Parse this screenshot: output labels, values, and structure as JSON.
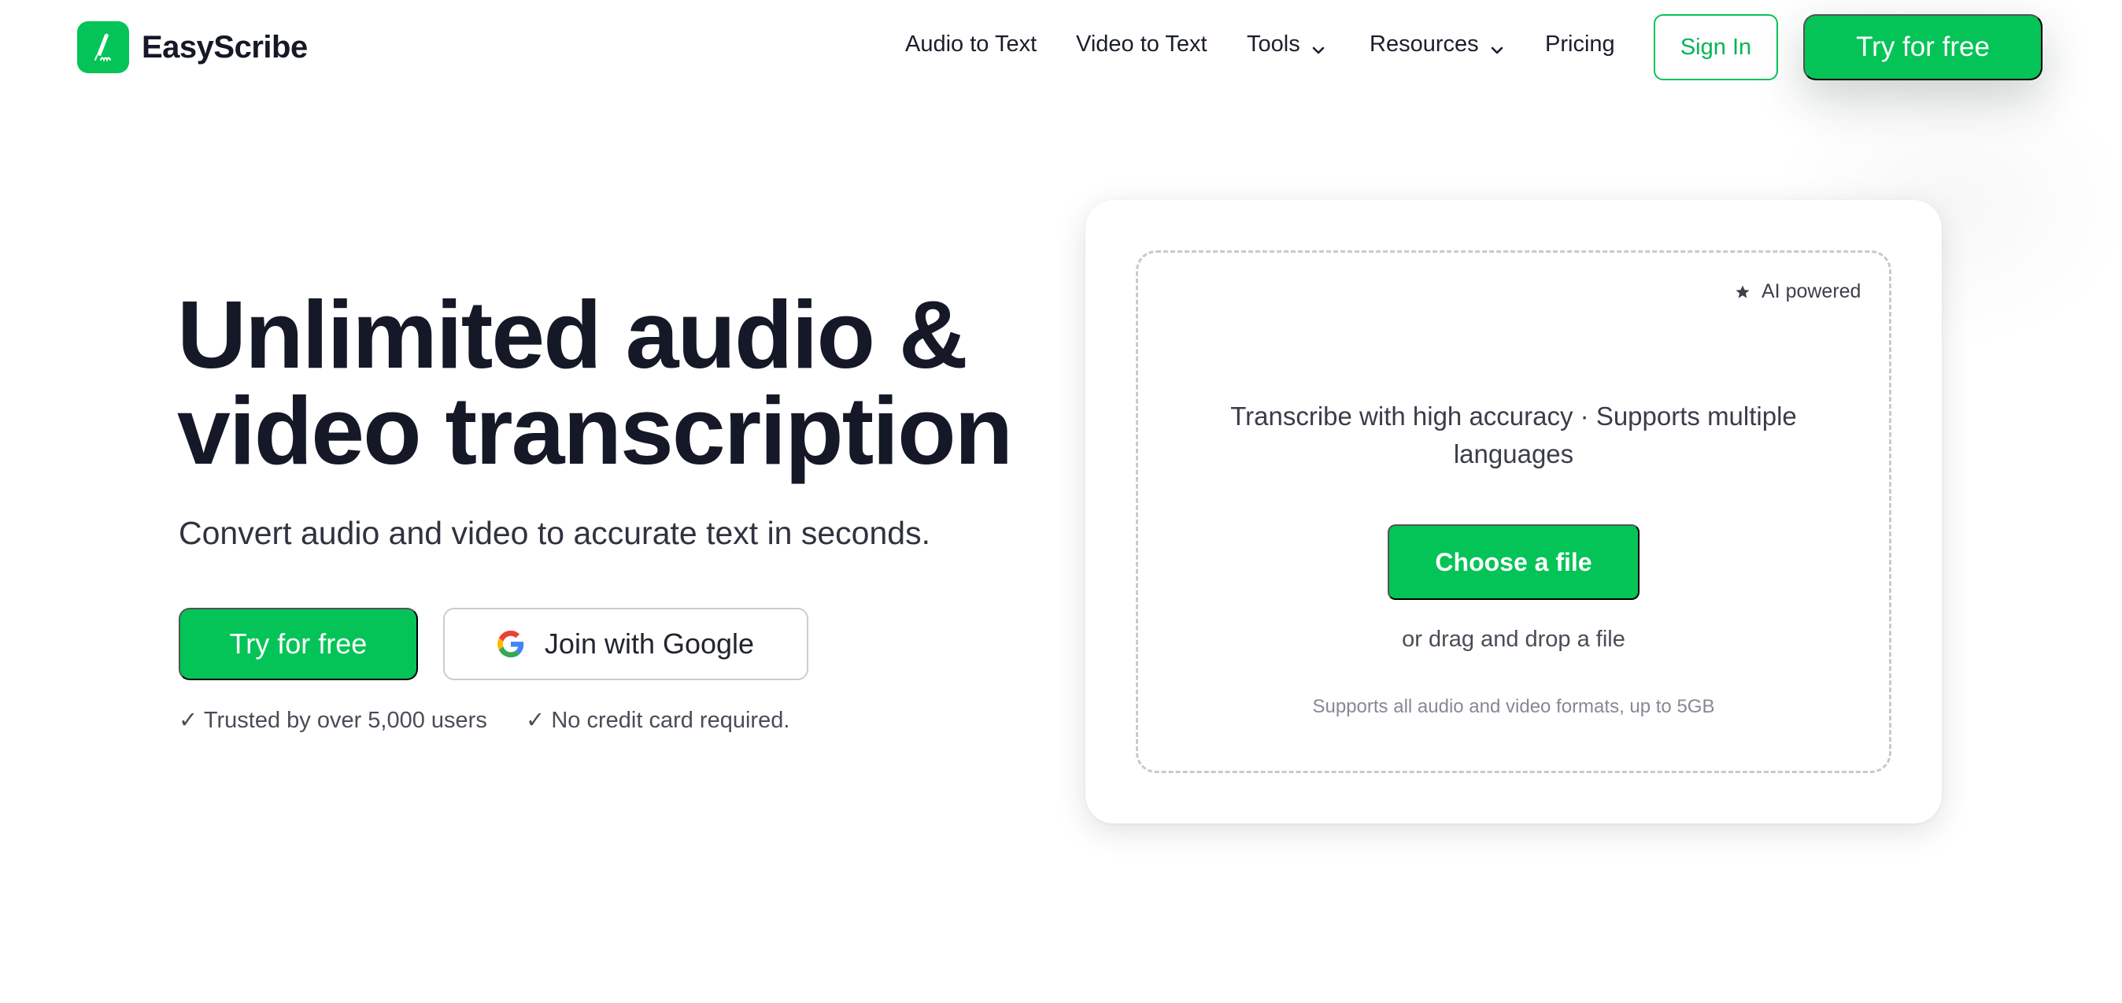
{
  "brand": {
    "name": "EasyScribe",
    "color": "#05c457"
  },
  "nav": {
    "items": [
      {
        "label": "Audio to Text",
        "icon": null
      },
      {
        "label": "Video to Text",
        "icon": null
      },
      {
        "label": "Tools",
        "icon": "chevron-down-icon"
      },
      {
        "label": "Resources",
        "icon": "chevron-down-icon"
      },
      {
        "label": "Pricing",
        "icon": null
      }
    ],
    "sign_in": "Sign In",
    "try_free": "Try for free"
  },
  "hero": {
    "headline_line1": "Unlimited audio &",
    "headline_line2": "video transcription",
    "subhead": "Convert audio and video to accurate text in seconds.",
    "try_free": "Try for free",
    "google": "Join with Google",
    "trust": [
      "✓ Trusted by over 5,000 users",
      "✓ No credit card required."
    ]
  },
  "upload": {
    "badge": "AI powered",
    "description": "Transcribe with high accuracy · Supports multiple languages",
    "button": "Choose a file",
    "drag_text": "or drag and drop a file",
    "formats": "Supports all audio and video formats, up to 5GB"
  }
}
